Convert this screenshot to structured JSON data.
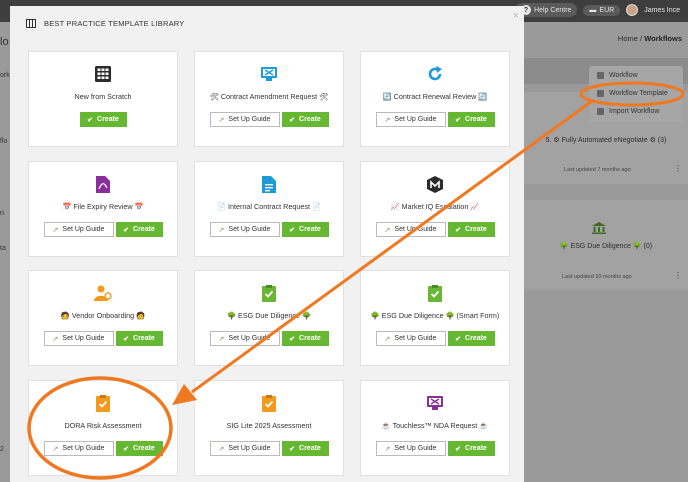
{
  "app": {
    "help_label": "Help Centre",
    "currency": "EUR",
    "user_name": "James Ince",
    "breadcrumb_home": "Home",
    "breadcrumb_sep": " / ",
    "breadcrumb_current": "Workflows"
  },
  "dropdown": {
    "items": [
      {
        "label": "Workflow"
      },
      {
        "label": "Workflow Template"
      },
      {
        "label": "Import Workflow"
      }
    ]
  },
  "background_cards": [
    {
      "title": "5. ⚙ Fully Automated eNegotiate ⚙ (3)",
      "updated": "Last updated 7 months ago"
    },
    {
      "title": "🌳 ESG Due Diligence 🌳 (0)",
      "updated": "Last updated 10 months ago"
    }
  ],
  "left_fragments": [
    "lo",
    "orkfl",
    "flo",
    "ri",
    "ta",
    "2"
  ],
  "modal": {
    "title": "BEST PRACTICE TEMPLATE LIBRARY",
    "close": "×",
    "guide_label": "Set Up Guide",
    "create_label": "Create",
    "templates": [
      {
        "name": "New from Scratch",
        "icon": "grid-icon"
      },
      {
        "name": "🛠 Contract Amendment Request 🛠",
        "icon": "monitor-icon"
      },
      {
        "name": "🔄 Contract Renewal Review 🔄",
        "icon": "refresh-icon"
      },
      {
        "name": "📅 File Expiry Review 📅",
        "icon": "pdf-icon"
      },
      {
        "name": "📄 Internal Contract Request 📄",
        "icon": "document-icon"
      },
      {
        "name": "📈 Market IQ Escalation 📈",
        "icon": "m-logo-icon"
      },
      {
        "name": "🧑 Vendor Onboarding 🧑",
        "icon": "user-gear-icon"
      },
      {
        "name": "🌳 ESG Due Diligence 🌳",
        "icon": "checklist-icon"
      },
      {
        "name": "🌳 ESG Due Diligence 🌳 (Smart Form)",
        "icon": "checklist-icon"
      },
      {
        "name": "DORA Risk Assessment",
        "icon": "checklist-icon"
      },
      {
        "name": "SIG Lite 2025 Assessment",
        "icon": "checklist-icon"
      },
      {
        "name": "☕ Touchless™ NDA Request ☕",
        "icon": "monitor-icon"
      }
    ]
  },
  "colors": {
    "accent_green": "#66b832",
    "annotation_orange": "#f07820",
    "icon_blue": "#1e9ad6",
    "icon_orange": "#f39a1e",
    "icon_purple": "#8a2e9c",
    "icon_green": "#6ab534"
  }
}
